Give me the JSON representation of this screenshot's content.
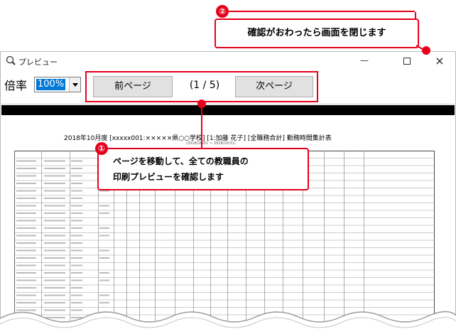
{
  "window": {
    "title": "プレビュー",
    "minimize_glyph": "—",
    "close_glyph": "×"
  },
  "toolbar": {
    "zoom_label": "倍率",
    "zoom_value": "100%",
    "prev_label": "前ページ",
    "page_indicator": "(1 / 5)",
    "next_label": "次ページ"
  },
  "report": {
    "title": "2018年10月度 [xxxxx001:×××××県○○学校] [1:加藤 花子] [全職務合計] 勤務時間集計表",
    "subtitle": "(2018/10/01 ～ 2018/10/31)"
  },
  "callouts": {
    "one": {
      "badge": "①",
      "line1": "ページを移動して、全ての教職員の",
      "line2": "印刷プレビューを確認します"
    },
    "two": {
      "badge": "②",
      "text": "確認がおわったら画面を閉じます"
    }
  },
  "colors": {
    "accent": "#e5001c",
    "selection": "#0078d7"
  }
}
